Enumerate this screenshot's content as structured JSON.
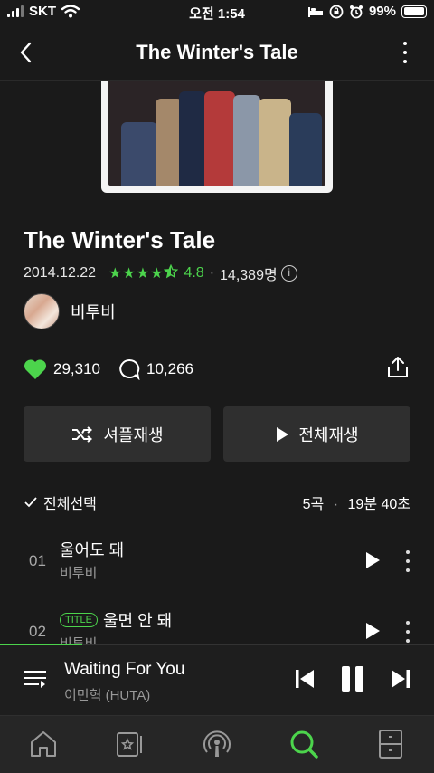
{
  "status": {
    "carrier": "SKT",
    "time": "오전 1:54",
    "battery": "99%",
    "battery_level": 0.99
  },
  "nav": {
    "title": "The Winter's Tale"
  },
  "album": {
    "title": "The Winter's Tale",
    "release_date": "2014.12.22",
    "rating_stars": 4.5,
    "rating": "4.8",
    "rating_count": "14,389명",
    "artist": "비투비",
    "likes": "29,310",
    "comments": "10,266"
  },
  "buttons": {
    "shuffle": "셔플재생",
    "play_all": "전체재생"
  },
  "list": {
    "select_all": "전체선택",
    "track_count": "5곡",
    "duration": "19분 40초"
  },
  "tracks": [
    {
      "num": "01",
      "title": "울어도 돼",
      "artist": "비투비",
      "badge": ""
    },
    {
      "num": "02",
      "title": "울면 안 돼",
      "artist": "비투비",
      "badge": "TITLE"
    }
  ],
  "player": {
    "title": "Waiting For You",
    "artist": "이민혁 (HUTA)",
    "progress": 0.19
  },
  "colors": {
    "accent": "#4cd44c",
    "background": "#1a1a1a",
    "button": "#2f2f2f"
  },
  "tabs": [
    "home-icon",
    "library-icon",
    "podcast-icon",
    "search-icon",
    "storage-icon"
  ]
}
